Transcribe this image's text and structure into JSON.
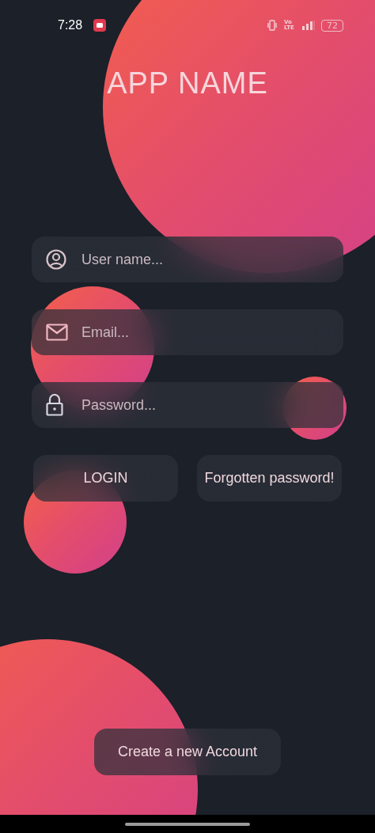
{
  "status_bar": {
    "time": "7:28",
    "network": "Vo LTE",
    "battery": "72"
  },
  "title": "APP NAME",
  "fields": [
    {
      "kind": "user",
      "placeholder": "User name..."
    },
    {
      "kind": "email",
      "placeholder": "Email..."
    },
    {
      "kind": "password",
      "placeholder": "Password..."
    }
  ],
  "buttons": [
    {
      "label": "LOGIN"
    },
    {
      "label": "Forgotten password!"
    }
  ],
  "create_account": "Create a new Account"
}
